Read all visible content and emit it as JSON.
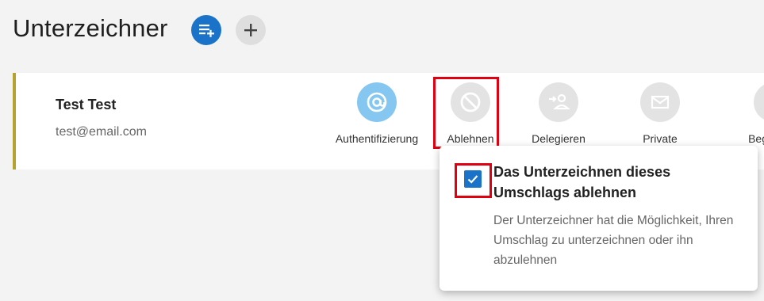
{
  "page": {
    "title": "Unterzeichner"
  },
  "header_buttons": [
    {
      "icon": "playlist-add-icon",
      "color": "#1a73c8"
    },
    {
      "icon": "plus-icon",
      "color": "#dedede"
    }
  ],
  "signer": {
    "name": "Test Test",
    "email": "test@email.com",
    "accent_color": "#b5a22f"
  },
  "options": [
    {
      "label": "Authentifizierung",
      "icon": "at-icon",
      "active": true
    },
    {
      "label": "Ablehnen",
      "icon": "block-icon",
      "active": false,
      "highlighted": true
    },
    {
      "label": "Delegieren",
      "icon": "delegate-icon",
      "active": false
    },
    {
      "label": "Private",
      "icon": "mail-icon",
      "active": false
    },
    {
      "label": "Beg… k…",
      "icon": "circle-icon",
      "active": false
    }
  ],
  "popup": {
    "checkbox_checked": true,
    "title": "Das Unterzeichnen dieses Umschlags ablehnen",
    "description": "Der Unterzeichner hat die Möglichkeit, Ihren Umschlag zu unterzeichnen oder ihn abzulehnen"
  },
  "colors": {
    "primary": "#1a73c8",
    "highlight": "#e00010",
    "active_icon_bg": "#85c7f0"
  }
}
